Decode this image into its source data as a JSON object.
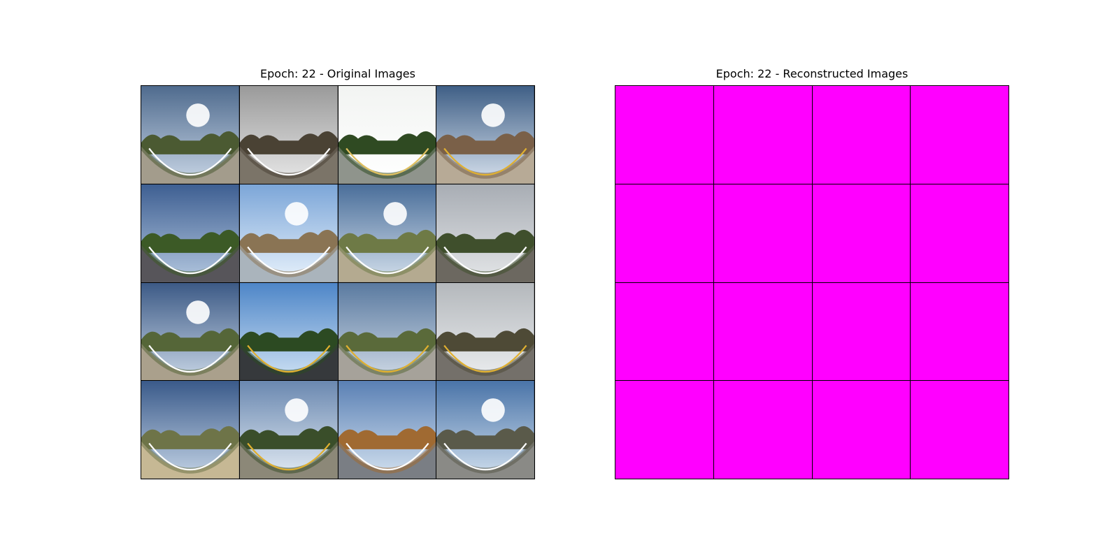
{
  "figure": {
    "left": {
      "title": "Epoch: 22 - Original Images",
      "tiles": [
        {
          "sky_top": "#4f6b8e",
          "sky_bottom": "#c9d6e6",
          "ground": "#a39c8c",
          "vegetation": "#4b5a32",
          "sun": true,
          "line": "#ffffff"
        },
        {
          "sky_top": "#9a9a9a",
          "sky_bottom": "#e8e8e8",
          "ground": "#7b7468",
          "vegetation": "#4a4234",
          "sun": false,
          "line": "#ffffff"
        },
        {
          "sky_top": "#f2f4f2",
          "sky_bottom": "#ffffff",
          "ground": "#8f948c",
          "vegetation": "#2f4a22",
          "sun": false,
          "line": "#e0c060"
        },
        {
          "sky_top": "#3f5f86",
          "sky_bottom": "#d8e2ee",
          "ground": "#b7aa96",
          "vegetation": "#7a6048",
          "sun": true,
          "line": "#e0b030"
        },
        {
          "sky_top": "#3e5f92",
          "sky_bottom": "#b4c8e0",
          "ground": "#57555a",
          "vegetation": "#3c5a26",
          "sun": false,
          "line": "#ffffff"
        },
        {
          "sky_top": "#7ca6d8",
          "sky_bottom": "#e8f2fc",
          "ground": "#aab4bc",
          "vegetation": "#8a7454",
          "sun": true,
          "line": "#ffffff"
        },
        {
          "sky_top": "#4a6e9a",
          "sky_bottom": "#d4e0ec",
          "ground": "#b4aa90",
          "vegetation": "#6e7a46",
          "sun": true,
          "line": "#ffffff"
        },
        {
          "sky_top": "#a8adb4",
          "sky_bottom": "#e4e6e8",
          "ground": "#6c6860",
          "vegetation": "#3f4f2c",
          "sun": false,
          "line": "#ffffff"
        },
        {
          "sky_top": "#3c5a86",
          "sky_bottom": "#c8d6e6",
          "ground": "#aaa08c",
          "vegetation": "#556638",
          "sun": true,
          "line": "#ffffff"
        },
        {
          "sky_top": "#4e86c8",
          "sky_bottom": "#cfe2f4",
          "ground": "#36393c",
          "vegetation": "#2c4a22",
          "sun": false,
          "line": "#e0b030"
        },
        {
          "sky_top": "#5a7aa0",
          "sky_bottom": "#d0dae6",
          "ground": "#a6a29a",
          "vegetation": "#5a6a3a",
          "sun": false,
          "line": "#e0b030"
        },
        {
          "sky_top": "#b4b8bc",
          "sky_bottom": "#eceef0",
          "ground": "#74706a",
          "vegetation": "#4e4a36",
          "sun": false,
          "line": "#e0b030"
        },
        {
          "sky_top": "#3a5a8a",
          "sky_bottom": "#c4d4e6",
          "ground": "#c6b894",
          "vegetation": "#6e7448",
          "sun": false,
          "line": "#ffffff"
        },
        {
          "sky_top": "#6a88b0",
          "sky_bottom": "#e4ecf4",
          "ground": "#8c8878",
          "vegetation": "#3a4e2a",
          "sun": true,
          "line": "#e0b030"
        },
        {
          "sky_top": "#5a80b4",
          "sky_bottom": "#d4e2f0",
          "ground": "#7a7e84",
          "vegetation": "#a06a32",
          "sun": false,
          "line": "#ffffff"
        },
        {
          "sky_top": "#4a74a8",
          "sky_bottom": "#d0dfee",
          "ground": "#8a8a86",
          "vegetation": "#5a5a4a",
          "sun": true,
          "line": "#ffffff"
        }
      ]
    },
    "right": {
      "title": "Epoch: 22 - Reconstructed Images",
      "tile_color": "#ff00ff",
      "tile_count": 16
    }
  }
}
